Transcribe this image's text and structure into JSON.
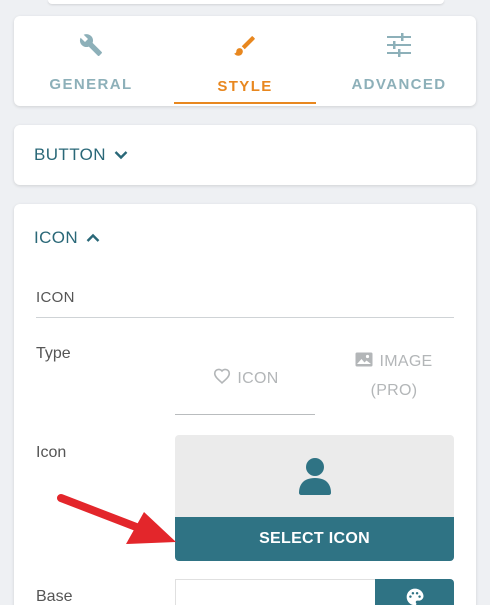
{
  "tabs": [
    {
      "label": "GENERAL",
      "icon": "wrench-icon",
      "active": false
    },
    {
      "label": "STYLE",
      "icon": "paintbrush-icon",
      "active": true
    },
    {
      "label": "ADVANCED",
      "icon": "sliders-icon",
      "active": false
    }
  ],
  "sections": {
    "button": {
      "title": "BUTTON",
      "state": "collapsed"
    },
    "icon": {
      "title": "ICON",
      "state": "expanded"
    }
  },
  "icon_settings": {
    "subtitle": "ICON",
    "type_label": "Type",
    "type_options": {
      "icon": "ICON",
      "image": "IMAGE",
      "image_note": "(PRO)"
    },
    "icon_label": "Icon",
    "select_button": "SELECT ICON",
    "base_label": "Base"
  },
  "colors": {
    "accent": "#e8871f",
    "primary": "#2f7384",
    "tab_inactive": "#8db0b9",
    "arrow": "#e3262b"
  }
}
